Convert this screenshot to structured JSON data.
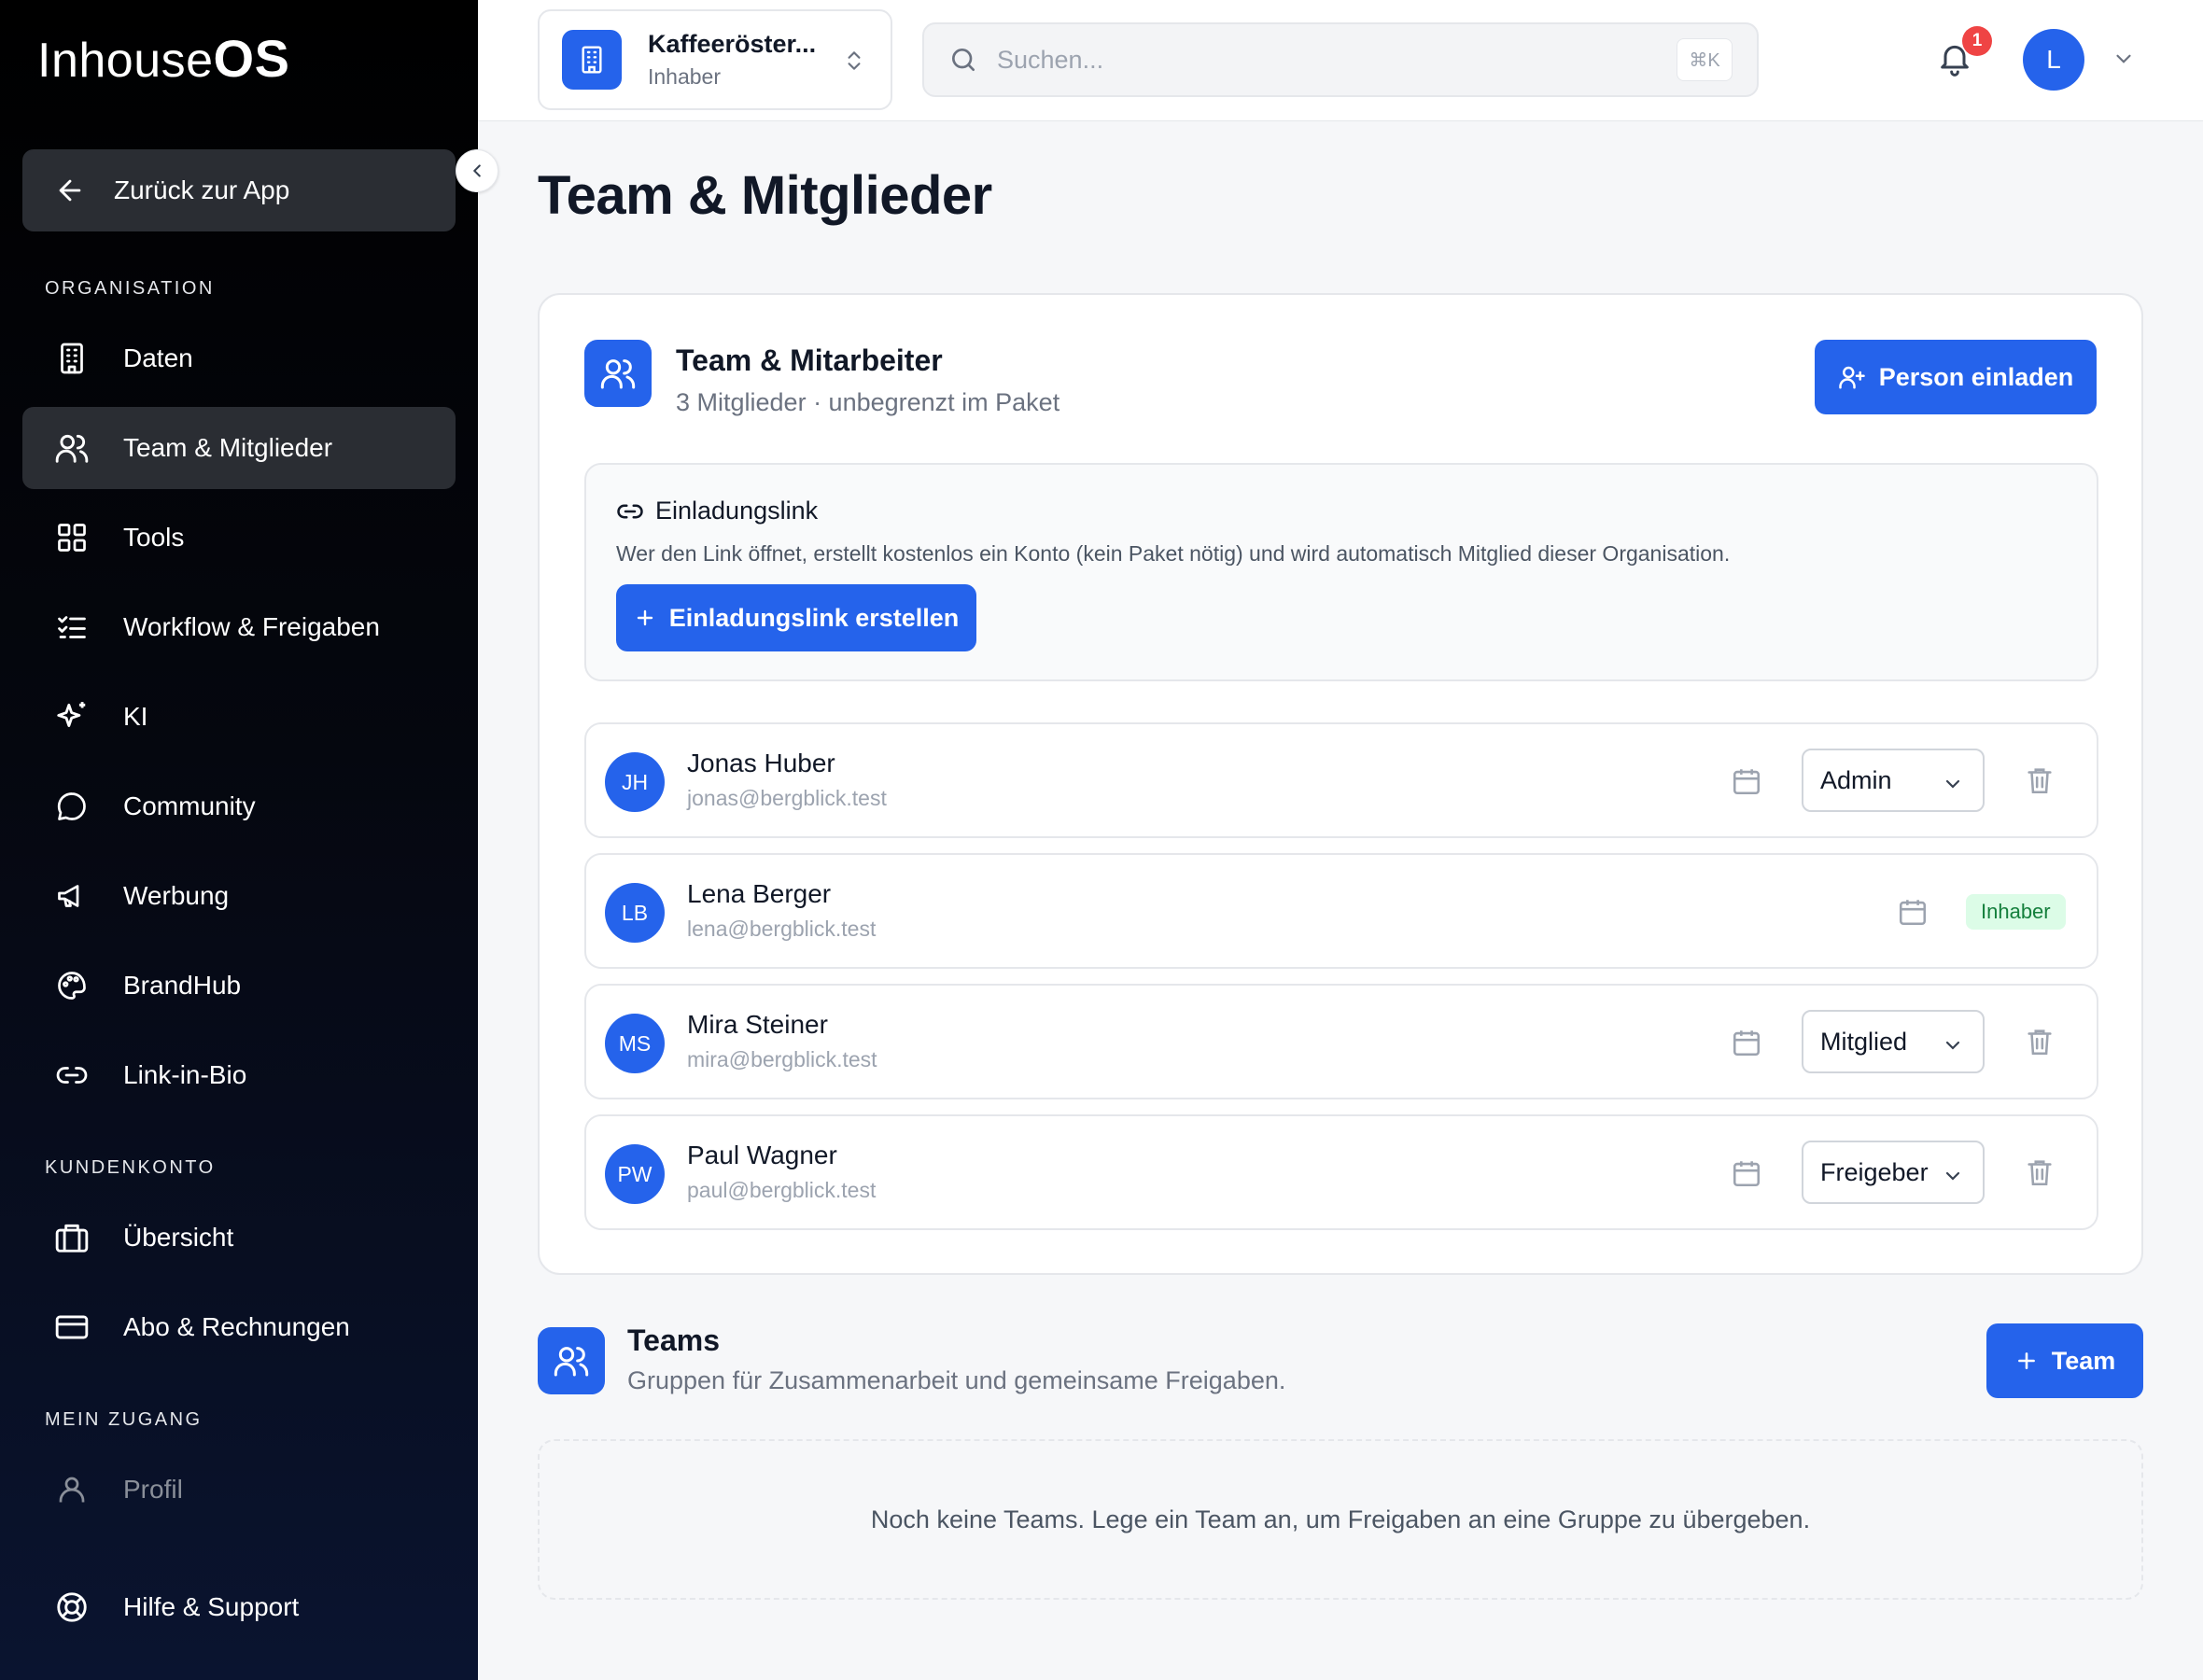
{
  "sidebar": {
    "logo": {
      "light": "Inhouse",
      "bold": "OS"
    },
    "back": "Zurück zur App",
    "sections": {
      "organisation": "ORGANISATION",
      "kundenkonto": "KUNDENKONTO",
      "zugang": "MEIN ZUGANG"
    },
    "items": [
      {
        "label": "Daten",
        "icon": "building-icon"
      },
      {
        "label": "Team & Mitglieder",
        "icon": "users-icon",
        "active": true
      },
      {
        "label": "Tools",
        "icon": "grid-icon"
      },
      {
        "label": "Workflow & Freigaben",
        "icon": "checklist-icon"
      },
      {
        "label": "KI",
        "icon": "sparkles-icon"
      },
      {
        "label": "Community",
        "icon": "chat-icon"
      },
      {
        "label": "Werbung",
        "icon": "megaphone-icon"
      },
      {
        "label": "BrandHub",
        "icon": "palette-icon"
      },
      {
        "label": "Link-in-Bio",
        "icon": "link-icon"
      },
      {
        "label": "Übersicht",
        "icon": "briefcase-icon"
      },
      {
        "label": "Abo & Rechnungen",
        "icon": "credit-card-icon"
      },
      {
        "label": "Profil",
        "icon": "user-icon"
      },
      {
        "label": "Hilfe & Support",
        "icon": "lifebuoy-icon"
      }
    ]
  },
  "topbar": {
    "org_name": "Kaffeeröster...",
    "org_role": "Inhaber",
    "search_placeholder": "Suchen...",
    "search_shortcut": "⌘K",
    "notification_count": "1",
    "avatar_initial": "L"
  },
  "page": {
    "title": "Team & Mitglieder"
  },
  "team_card": {
    "title": "Team & Mitarbeiter",
    "subtitle": "3 Mitglieder · unbegrenzt im Paket",
    "invite_button": "Person einladen",
    "invite_link": {
      "title": "Einladungslink",
      "description": "Wer den Link öffnet, erstellt kostenlos ein Konto (kein Paket nötig) und wird automatisch Mitglied dieser Organisation.",
      "button": "Einladungslink erstellen"
    },
    "members": [
      {
        "initials": "JH",
        "name": "Jonas Huber",
        "email": "jonas@bergblick.test",
        "role": "Admin"
      },
      {
        "initials": "LB",
        "name": "Lena Berger",
        "email": "lena@bergblick.test",
        "badge": "Inhaber"
      },
      {
        "initials": "MS",
        "name": "Mira Steiner",
        "email": "mira@bergblick.test",
        "role": "Mitglied"
      },
      {
        "initials": "PW",
        "name": "Paul Wagner",
        "email": "paul@bergblick.test",
        "role": "Freigeber"
      }
    ]
  },
  "teams": {
    "title": "Teams",
    "subtitle": "Gruppen für Zusammenarbeit und gemeinsame Freigaben.",
    "add_button": "Team",
    "empty": "Noch keine Teams. Lege ein Team an, um Freigaben an eine Gruppe zu übergeben."
  }
}
